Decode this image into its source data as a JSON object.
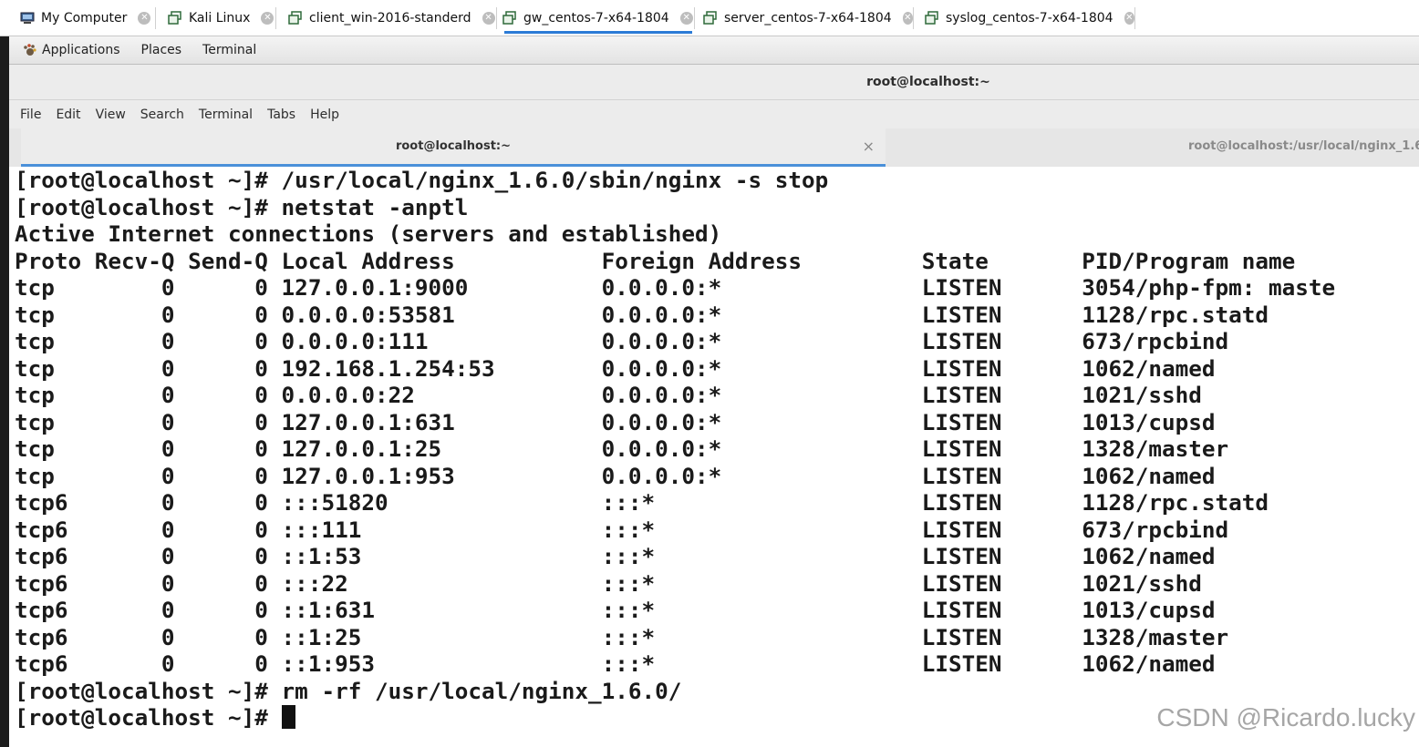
{
  "vm_tabs": [
    {
      "label": "My Computer",
      "icon": "computer-icon",
      "active": false
    },
    {
      "label": "Kali Linux",
      "icon": "vm-icon",
      "active": false
    },
    {
      "label": "client_win-2016-standerd",
      "icon": "vm-icon",
      "active": false
    },
    {
      "label": "gw_centos-7-x64-1804",
      "icon": "vm-icon",
      "active": true
    },
    {
      "label": "server_centos-7-x64-1804",
      "icon": "vm-icon",
      "active": false
    },
    {
      "label": "syslog_centos-7-x64-1804",
      "icon": "vm-icon",
      "active": false
    }
  ],
  "gnome_bar": {
    "applications": "Applications",
    "places": "Places",
    "terminal": "Terminal"
  },
  "window_title": "root@localhost:~",
  "menu": [
    "File",
    "Edit",
    "View",
    "Search",
    "Terminal",
    "Tabs",
    "Help"
  ],
  "terminal_tabs": [
    {
      "label": "root@localhost:~",
      "active": true
    },
    {
      "label": "root@localhost:/usr/local/nginx_1.6",
      "active": false
    }
  ],
  "terminal_lines": [
    "[root@localhost ~]# /usr/local/nginx_1.6.0/sbin/nginx -s stop",
    "[root@localhost ~]# netstat -anptl",
    "Active Internet connections (servers and established)",
    "Proto Recv-Q Send-Q Local Address           Foreign Address         State       PID/Program name",
    "tcp        0      0 127.0.0.1:9000          0.0.0.0:*               LISTEN      3054/php-fpm: maste",
    "tcp        0      0 0.0.0.0:53581           0.0.0.0:*               LISTEN      1128/rpc.statd",
    "tcp        0      0 0.0.0.0:111             0.0.0.0:*               LISTEN      673/rpcbind",
    "tcp        0      0 192.168.1.254:53        0.0.0.0:*               LISTEN      1062/named",
    "tcp        0      0 0.0.0.0:22              0.0.0.0:*               LISTEN      1021/sshd",
    "tcp        0      0 127.0.0.1:631           0.0.0.0:*               LISTEN      1013/cupsd",
    "tcp        0      0 127.0.0.1:25            0.0.0.0:*               LISTEN      1328/master",
    "tcp        0      0 127.0.0.1:953           0.0.0.0:*               LISTEN      1062/named",
    "tcp6       0      0 :::51820                :::*                    LISTEN      1128/rpc.statd",
    "tcp6       0      0 :::111                  :::*                    LISTEN      673/rpcbind",
    "tcp6       0      0 ::1:53                  :::*                    LISTEN      1062/named",
    "tcp6       0      0 :::22                   :::*                    LISTEN      1021/sshd",
    "tcp6       0      0 ::1:631                 :::*                    LISTEN      1013/cupsd",
    "tcp6       0      0 ::1:25                  :::*                    LISTEN      1328/master",
    "tcp6       0      0 ::1:953                 :::*                    LISTEN      1062/named",
    "[root@localhost ~]# rm -rf /usr/local/nginx_1.6.0/"
  ],
  "prompt": "[root@localhost ~]# ",
  "watermark": "CSDN @Ricardo.lucky",
  "colors": {
    "active_tab_underline": "#2b7bd6",
    "terminal_bg": "#ffffff",
    "terminal_fg": "#1a1a1a"
  }
}
